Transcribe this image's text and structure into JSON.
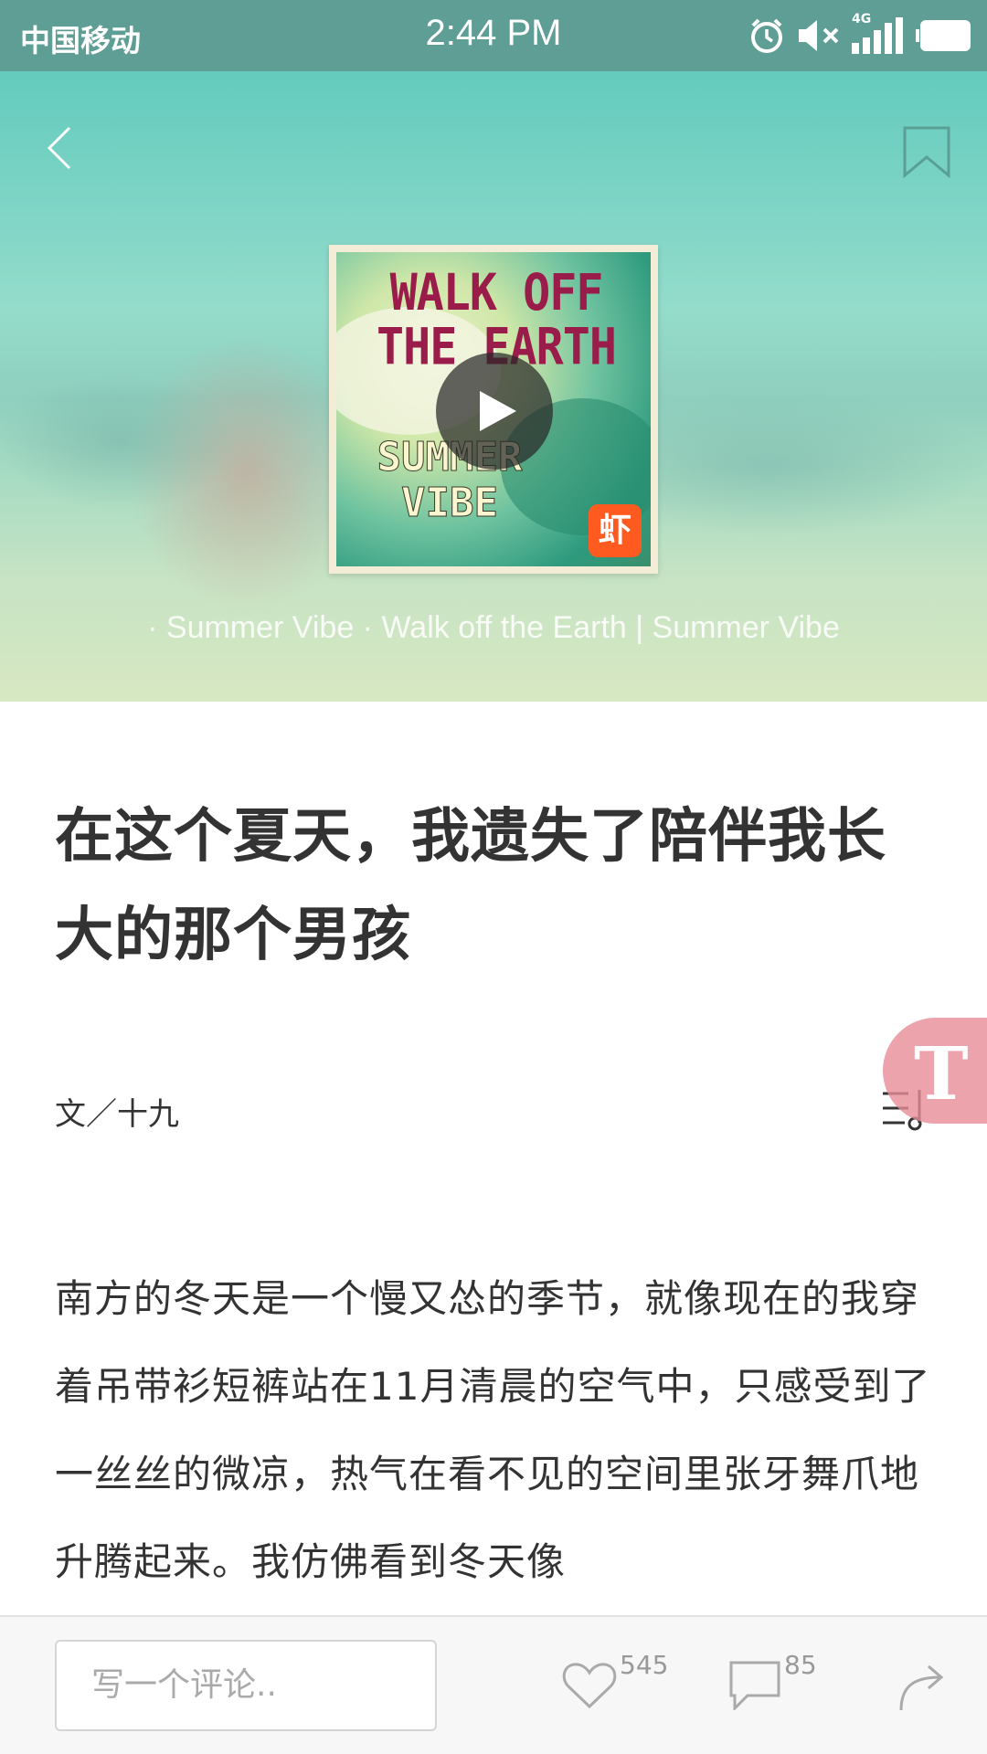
{
  "status_bar": {
    "carrier": "中国移动",
    "time": "2:44 PM",
    "network": "4G"
  },
  "hero": {
    "song_caption": "· Summer Vibe · Walk off the Earth | Summer Vibe",
    "album_cover": {
      "title_line1": "WALK OFF",
      "title_line2": "THE EARTH",
      "subtitle_line1": "SUMMER",
      "subtitle_line2": "VIBE",
      "badge": "虾"
    }
  },
  "article": {
    "title": "在这个夏天，我遗失了陪伴我长大的那个男孩",
    "author": "文／十九",
    "body": "南方的冬天是一个慢又怂的季节，就像现在的我穿着吊带衫短裤站在11月清晨的空气中，只感受到了一丝丝的微凉，热气在看不见的空间里张牙舞爪地升腾起来。我仿佛看到冬天像"
  },
  "bottom_bar": {
    "comment_placeholder": "写一个评论..",
    "like_count": "545",
    "comment_count": "85"
  },
  "colors": {
    "status_bar": "#5f9e95",
    "float_button": "#e88c96",
    "xiami_orange": "#ff5a1f",
    "text": "#333333"
  }
}
